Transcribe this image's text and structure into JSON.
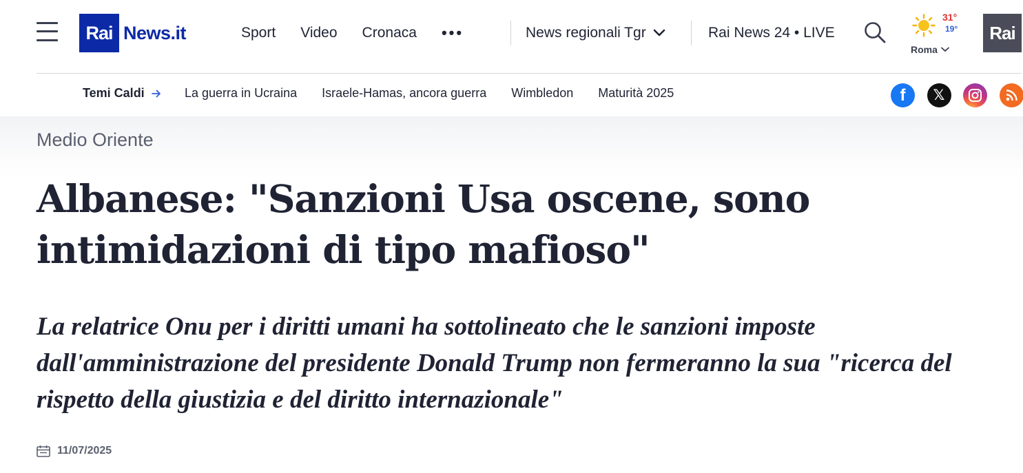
{
  "header": {
    "logo_rai": "Rai",
    "logo_news": "News.it",
    "nav": [
      "Sport",
      "Video",
      "Cronaca"
    ],
    "more": "•••",
    "regional": "News regionali Tgr",
    "live": "Rai News 24 • LIVE",
    "weather": {
      "max": "31°",
      "min": "19°",
      "city": "Roma"
    },
    "rai_brand": "Rai"
  },
  "hot_topics": {
    "label": "Temi Caldi",
    "items": [
      "La guerra in Ucraina",
      "Israele-Hamas, ancora guerra",
      "Wimbledon",
      "Maturità 2025"
    ]
  },
  "socials": {
    "facebook": "f",
    "x": "𝕏"
  },
  "article": {
    "category": "Medio Oriente",
    "title": "Albanese: \"Sanzioni Usa oscene, sono intimidazioni di tipo mafioso\"",
    "subtitle": "La relatrice Onu per i diritti umani ha sottolineato che le sanzioni imposte dall'amministrazione del presidente Donald Trump non fermeranno la sua \"ricerca del rispetto della giustizia e del diritto internazionale\"",
    "date": "11/07/2025"
  },
  "colors": {
    "brand_blue": "#0d2aa6",
    "temp_max": "#e0332f",
    "temp_min": "#2f5fd6",
    "facebook": "#1877f2",
    "rss": "#f26b21"
  },
  "icons": [
    "menu-icon",
    "chevron-down-icon",
    "search-icon",
    "sun-icon",
    "arrow-right-icon",
    "facebook-icon",
    "x-icon",
    "instagram-icon",
    "rss-icon",
    "calendar-icon"
  ]
}
